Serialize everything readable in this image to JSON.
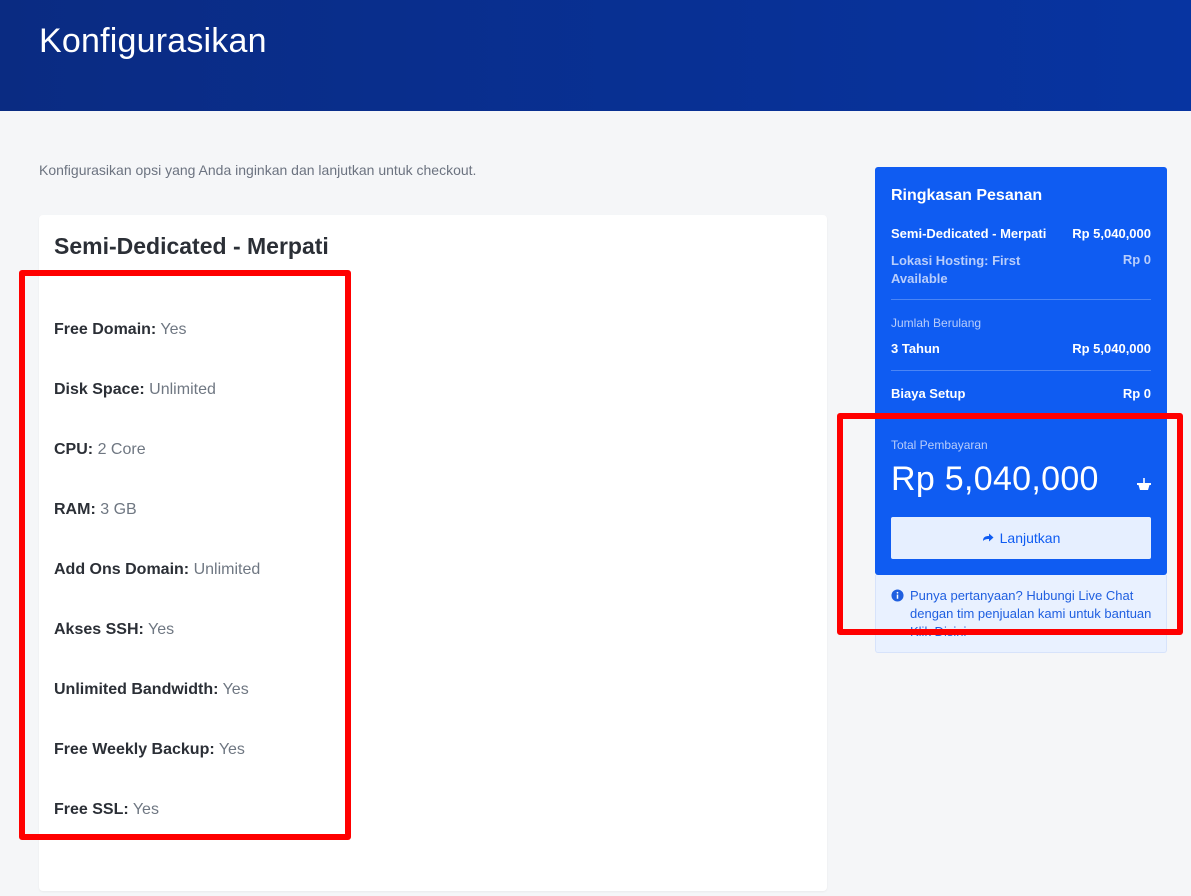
{
  "header": {
    "title": "Konfigurasikan"
  },
  "intro": "Konfigurasikan opsi yang Anda inginkan dan lanjutkan untuk checkout.",
  "product": {
    "name": "Semi-Dedicated - Merpati",
    "features": [
      {
        "label": "Free Domain:",
        "value": "Yes"
      },
      {
        "label": "Disk Space:",
        "value": "Unlimited"
      },
      {
        "label": "CPU:",
        "value": "2 Core"
      },
      {
        "label": "RAM:",
        "value": "3 GB"
      },
      {
        "label": "Add Ons Domain:",
        "value": "Unlimited"
      },
      {
        "label": "Akses SSH:",
        "value": "Yes"
      },
      {
        "label": "Unlimited Bandwidth:",
        "value": "Yes"
      },
      {
        "label": "Free Weekly Backup:",
        "value": "Yes"
      },
      {
        "label": "Free SSL:",
        "value": "Yes"
      }
    ]
  },
  "summary": {
    "title": "Ringkasan Pesanan",
    "product_label": "Semi-Dedicated - Merpati",
    "product_price": "Rp 5,040,000",
    "location_label": "Lokasi Hosting: First Available",
    "location_price": "Rp 0",
    "recurring_label": "Jumlah Berulang",
    "recurring_period": "3 Tahun",
    "recurring_price": "Rp 5,040,000",
    "setup_label": "Biaya Setup",
    "setup_price": "Rp 0",
    "total_label": "Total Pembayaran",
    "total_value": "Rp 5,040,000",
    "continue_label": "Lanjutkan"
  },
  "help": {
    "text": "Punya pertanyaan? Hubungi Live Chat dengan tim penjualan kami untuk bantuan Klik Disini"
  },
  "colors": {
    "header": "#0734a1",
    "summary_bg": "#0f5cf2",
    "highlight": "#ff0000"
  },
  "icons": [
    "basket-icon",
    "arrow-right-icon",
    "info-icon"
  ]
}
